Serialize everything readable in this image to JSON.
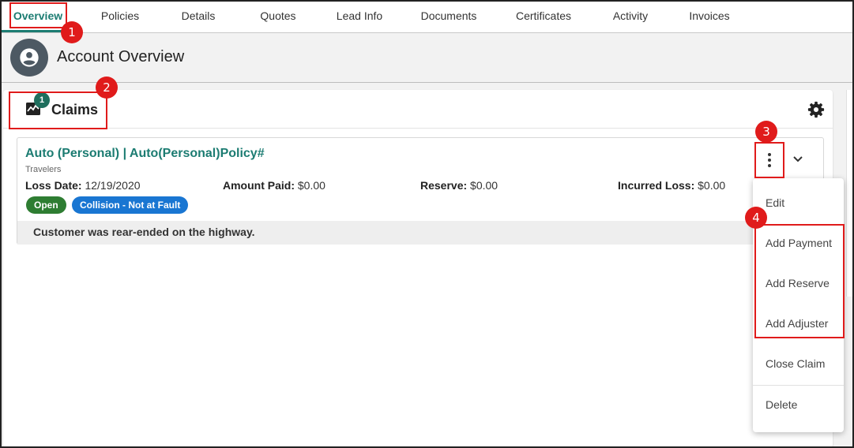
{
  "tabs": [
    {
      "label": "Overview",
      "active": true
    },
    {
      "label": "Policies"
    },
    {
      "label": "Details"
    },
    {
      "label": "Quotes"
    },
    {
      "label": "Lead Info"
    },
    {
      "label": "Documents"
    },
    {
      "label": "Certificates"
    },
    {
      "label": "Activity"
    },
    {
      "label": "Invoices"
    }
  ],
  "header": {
    "title": "Account Overview",
    "icon": "account-circle-icon"
  },
  "claims_card": {
    "title": "Claims",
    "count": "1",
    "icon": "claims-chart-icon",
    "settings_icon": "gear-icon"
  },
  "claim": {
    "title": "Auto (Personal) | Auto(Personal)Policy#",
    "carrier": "Travelers",
    "loss_date_label": "Loss Date:",
    "loss_date": "12/19/2020",
    "amount_paid_label": "Amount Paid:",
    "amount_paid": "$0.00",
    "reserve_label": "Reserve:",
    "reserve": "$0.00",
    "incurred_loss_label": "Incurred Loss:",
    "incurred_loss": "$0.00",
    "status_badge": "Open",
    "type_badge": "Collision - Not at Fault",
    "description": "Customer was rear-ended on the highway."
  },
  "menu": {
    "items": [
      "Edit",
      "Add Payment",
      "Add Reserve",
      "Add Adjuster",
      "Close Claim",
      "Delete"
    ]
  },
  "annotations": [
    "1",
    "2",
    "3",
    "4"
  ],
  "colors": {
    "accent": "#1c7c72",
    "open_badge": "#2e7d32",
    "type_badge": "#1976d2",
    "annotation": "#e01b1b",
    "avatar": "#4d5963"
  }
}
